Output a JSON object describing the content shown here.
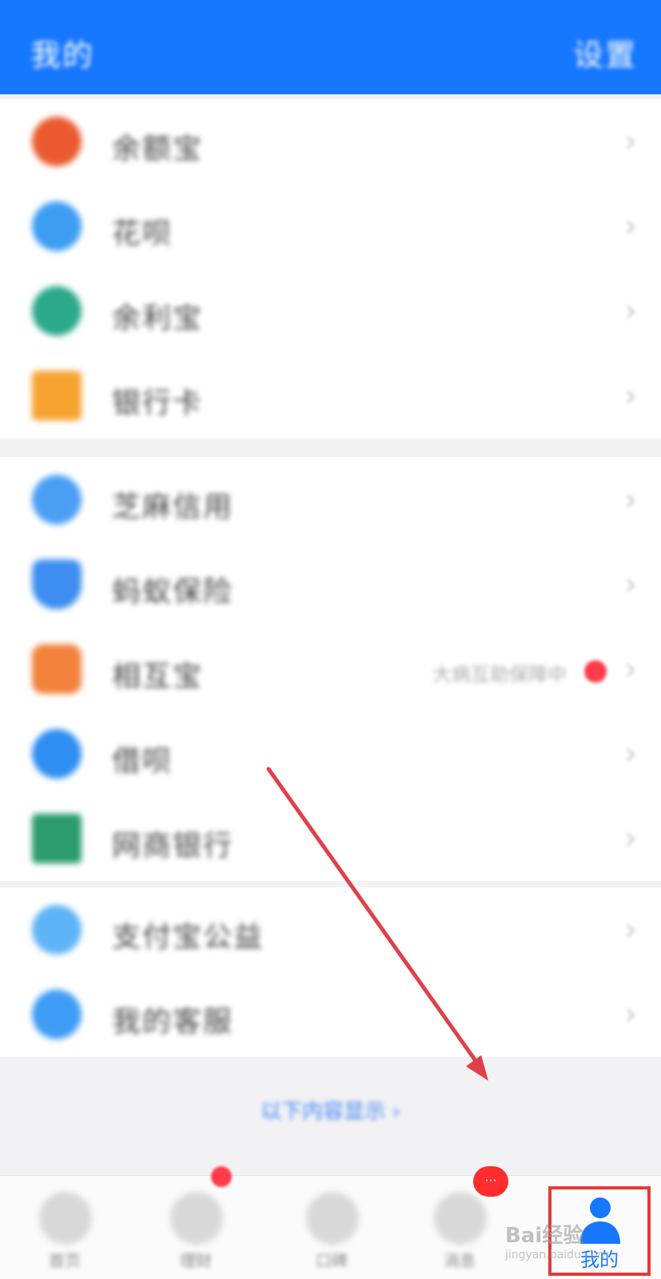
{
  "header": {
    "title": "我的",
    "settings_label": "设置"
  },
  "groups": [
    {
      "items": [
        {
          "label": "余额宝",
          "icon": "yuebao-icon",
          "color": "#ea5a2e",
          "glyph": ""
        },
        {
          "label": "花呗",
          "icon": "huabei-icon",
          "color": "#3d9df2",
          "glyph": ""
        },
        {
          "label": "余利宝",
          "icon": "yulibao-icon",
          "color": "#2ba98b",
          "glyph": ""
        },
        {
          "label": "银行卡",
          "icon": "bank-card-icon",
          "color": "#f6a330",
          "glyph": ""
        }
      ]
    },
    {
      "items": [
        {
          "label": "芝麻信用",
          "icon": "sesame-credit-icon",
          "color": "#4a9ff5",
          "glyph": ""
        },
        {
          "label": "蚂蚁保险",
          "icon": "insurance-shield-icon",
          "color": "#3d8ef0",
          "glyph": ""
        },
        {
          "label": "相互宝",
          "icon": "xianghubao-icon",
          "color": "#f2823c",
          "glyph": "",
          "extra": "大病互助保障中",
          "has_dot": true
        },
        {
          "label": "借呗",
          "icon": "jiebei-icon",
          "color": "#2e8ef2",
          "glyph": ""
        },
        {
          "label": "网商银行",
          "icon": "mybank-icon",
          "color": "#2c9b6e",
          "glyph": ""
        }
      ]
    },
    {
      "items": [
        {
          "label": "支付宝公益",
          "icon": "charity-icon",
          "color": "#5fb4f7",
          "glyph": ""
        },
        {
          "label": "我的客服",
          "icon": "customer-service-icon",
          "color": "#3f9cf5",
          "glyph": ""
        }
      ]
    }
  ],
  "more_link": "以下内容显示 ›",
  "tabbar": {
    "tabs": [
      {
        "label": "首页",
        "icon": "home-icon"
      },
      {
        "label": "理财",
        "icon": "wealth-icon",
        "badge": "dot"
      },
      {
        "label": "口碑",
        "icon": "koubei-icon"
      },
      {
        "label": "消息",
        "icon": "message-icon",
        "badge": "···"
      }
    ],
    "active_tab": {
      "label": "我的",
      "icon": "person-icon"
    }
  },
  "watermark": {
    "brand": "Bai经验",
    "url": "jingyan.baidu.com"
  },
  "colors": {
    "primary": "#1677ff",
    "highlight_border": "#e23a3a",
    "annotation_arrow": "#e0404a"
  }
}
